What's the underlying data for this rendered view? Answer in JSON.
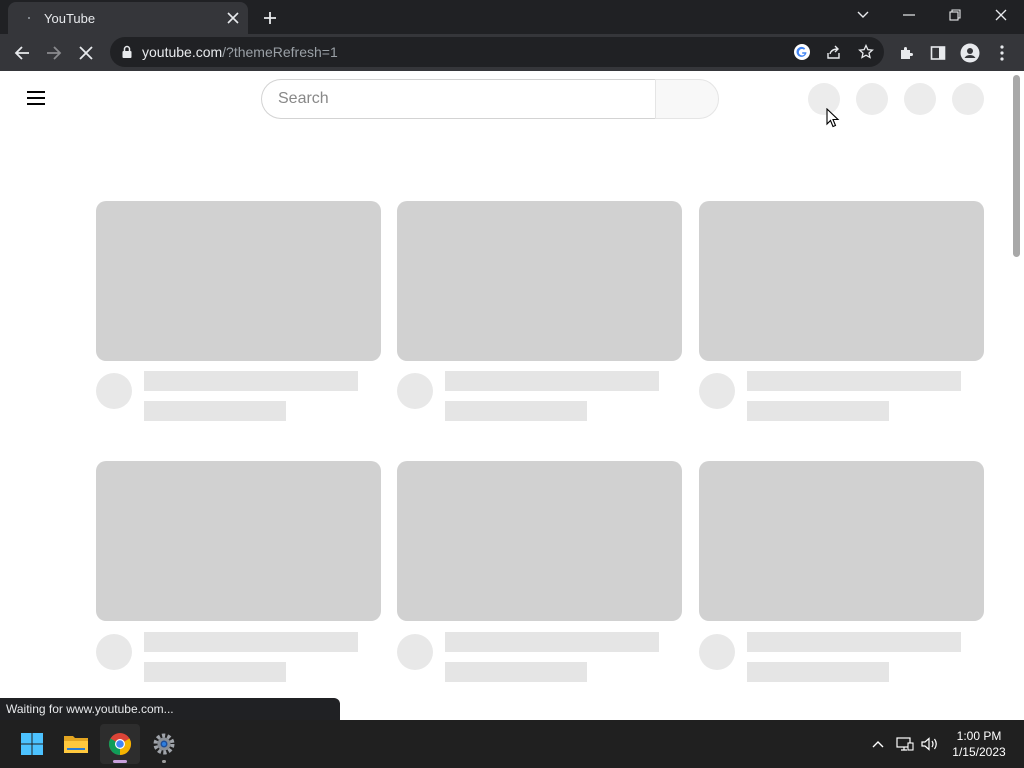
{
  "browser": {
    "tab_title": "YouTube",
    "url_host": "youtube.com",
    "url_rest": "/?themeRefresh=1",
    "status_text": "Waiting for www.youtube.com..."
  },
  "youtube": {
    "search_placeholder": "Search"
  },
  "taskbar": {
    "time": "1:00 PM",
    "date": "1/15/2023"
  },
  "colors": {
    "chrome_dark": "#202124",
    "toolbar": "#35363a",
    "skeleton_thumb": "#d1d1d1",
    "skeleton_line": "#e5e5e5"
  }
}
